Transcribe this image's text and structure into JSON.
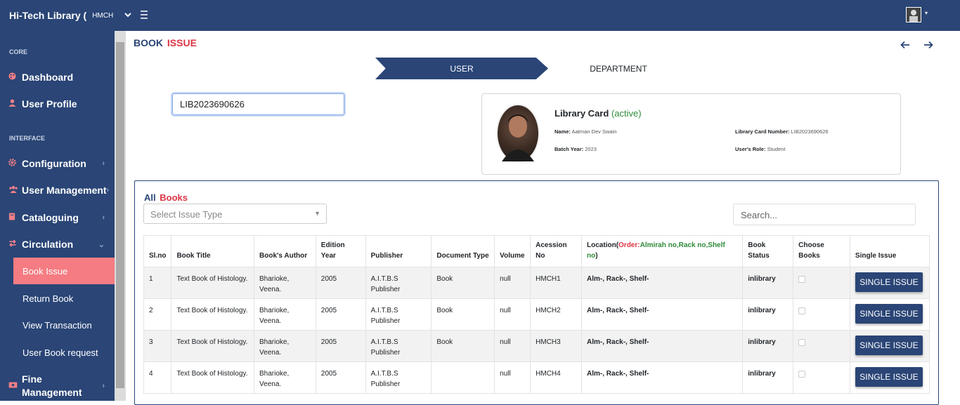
{
  "topbar": {
    "brand": "Hi-Tech Library (",
    "library_select": "HMCH",
    "toggle_icon": "bars-icon"
  },
  "sidebar": {
    "core_heading": "CORE",
    "dashboard": "Dashboard",
    "user_profile": "User Profile",
    "interface_heading": "INTERFACE",
    "configuration": "Configuration",
    "user_management": "User Management",
    "cataloguing": "Cataloguing",
    "circulation": "Circulation",
    "book_issue": "Book Issue",
    "return_book": "Return Book",
    "view_transaction": "View Transaction",
    "user_book_request": "User Book request",
    "fine_management_1": "Fine",
    "fine_management_2": "Management"
  },
  "page": {
    "title_part1": "BOOK",
    "title_part2": "ISSUE"
  },
  "steps": {
    "user": "USER",
    "department": "DEPARTMENT"
  },
  "card_input": {
    "value": "LIB2023690626"
  },
  "library_card": {
    "title": "Library Card",
    "status": "(active)",
    "name_label": "Name:",
    "name_value": "Aatman Dev Swain",
    "card_number_label": "Library Card Number:",
    "card_number_value": "LIB2023690626",
    "batch_label": "Batch Year:",
    "batch_value": "2023",
    "role_label": "User's Role:",
    "role_value": "Student"
  },
  "books": {
    "title_part1": "All",
    "title_part2": "Books",
    "issue_type_placeholder": "Select Issue Type",
    "search_placeholder": "Search...",
    "columns": {
      "slno": "Sl.no",
      "title": "Book Title",
      "author": "Book's Author",
      "edition": "Edition Year",
      "publisher": "Publisher",
      "doc_type": "Document Type",
      "volume": "Volume",
      "accession": "Acession No",
      "location_prefix": "Location(",
      "location_order": "Order:",
      "location_values": "Almirah no,Rack no,Shelf no",
      "location_suffix": ")",
      "status": "Book Status",
      "choose": "Choose Books",
      "single": "Single Issue"
    },
    "rows": [
      {
        "slno": "1",
        "title": "Text Book of Histology.",
        "author": "Bharioke, Veena.",
        "edition": "2005",
        "publisher": "A.I.T.B.S Publisher",
        "doc_type": "Book",
        "volume": "null",
        "accession": "HMCH1",
        "location": "Alm-, Rack-, Shelf-",
        "status": "inlibrary",
        "button": "SINGLE ISSUE"
      },
      {
        "slno": "2",
        "title": "Text Book of Histology.",
        "author": "Bharioke, Veena.",
        "edition": "2005",
        "publisher": "A.I.T.B.S Publisher",
        "doc_type": "Book",
        "volume": "null",
        "accession": "HMCH2",
        "location": "Alm-, Rack-, Shelf-",
        "status": "inlibrary",
        "button": "SINGLE ISSUE"
      },
      {
        "slno": "3",
        "title": "Text Book of Histology.",
        "author": "Bharioke, Veena.",
        "edition": "2005",
        "publisher": "A.I.T.B.S Publisher",
        "doc_type": "Book",
        "volume": "null",
        "accession": "HMCH3",
        "location": "Alm-, Rack-, Shelf-",
        "status": "inlibrary",
        "button": "SINGLE ISSUE"
      },
      {
        "slno": "4",
        "title": "Text Book of Histology.",
        "author": "Bharioke, Veena.",
        "edition": "2005",
        "publisher": "A.I.T.B.S Publisher",
        "doc_type": "",
        "volume": "null",
        "accession": "HMCH4",
        "location": "Alm-, Rack-, Shelf-",
        "status": "inlibrary",
        "button": "SINGLE ISSUE"
      }
    ]
  },
  "colors": {
    "primary": "#2a4576",
    "accent": "#dc3545",
    "active_nav": "#f47c82",
    "success": "#2e8b3a"
  }
}
